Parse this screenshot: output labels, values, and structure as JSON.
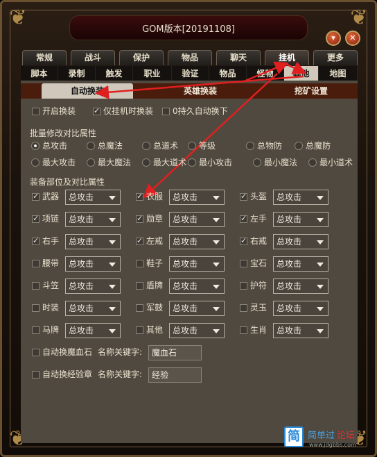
{
  "window": {
    "title": "GOM版本[20191108]",
    "minimize_glyph": "▾",
    "close_glyph": "✕"
  },
  "tabs_level1": [
    "常规",
    "战斗",
    "保护",
    "物品",
    "聊天",
    "挂机",
    "更多"
  ],
  "tabs_level1_active": "挂机",
  "tabs_level2": [
    "脚本",
    "录制",
    "触发",
    "职业",
    "验证",
    "物品",
    "怪物",
    "其他",
    "地图"
  ],
  "tabs_level2_active": "其他",
  "tabs_level3": [
    "自动换装",
    "英雄换装",
    "挖矿设置"
  ],
  "tabs_level3_active": "自动换装",
  "options": [
    {
      "label": "开启换装",
      "checked": false
    },
    {
      "label": "仅挂机时换装",
      "checked": true
    },
    {
      "label": "0持久自动换下",
      "checked": false
    }
  ],
  "batch_section": "批量修改对比属性",
  "radios_row1": [
    {
      "label": "总攻击",
      "checked": true
    },
    {
      "label": "总魔法",
      "checked": false
    },
    {
      "label": "总道术",
      "checked": false
    },
    {
      "label": "等级",
      "checked": false
    },
    {
      "label": "总物防",
      "checked": false
    },
    {
      "label": "总魔防",
      "checked": false
    }
  ],
  "radios_row2": [
    {
      "label": "最大攻击",
      "checked": false
    },
    {
      "label": "最大魔法",
      "checked": false
    },
    {
      "label": "最大道术",
      "checked": false
    },
    {
      "label": "最小攻击",
      "checked": false
    },
    {
      "label": "最小魔法",
      "checked": false
    },
    {
      "label": "最小道术",
      "checked": false
    }
  ],
  "equip_section": "装备部位及对比属性",
  "equipment": [
    {
      "label": "武器",
      "checked": true,
      "value": "总攻击"
    },
    {
      "label": "衣服",
      "checked": true,
      "value": "总攻击"
    },
    {
      "label": "头盔",
      "checked": true,
      "value": "总攻击"
    },
    {
      "label": "项链",
      "checked": true,
      "value": "总攻击"
    },
    {
      "label": "勋章",
      "checked": true,
      "value": "总攻击"
    },
    {
      "label": "左手",
      "checked": true,
      "value": "总攻击"
    },
    {
      "label": "右手",
      "checked": true,
      "value": "总攻击"
    },
    {
      "label": "左戒",
      "checked": true,
      "value": "总攻击"
    },
    {
      "label": "右戒",
      "checked": true,
      "value": "总攻击"
    },
    {
      "label": "腰带",
      "checked": false,
      "value": "总攻击"
    },
    {
      "label": "鞋子",
      "checked": false,
      "value": "总攻击"
    },
    {
      "label": "宝石",
      "checked": false,
      "value": "总攻击"
    },
    {
      "label": "斗笠",
      "checked": false,
      "value": "总攻击"
    },
    {
      "label": "盾牌",
      "checked": false,
      "value": "总攻击"
    },
    {
      "label": "护符",
      "checked": false,
      "value": "总攻击"
    },
    {
      "label": "时装",
      "checked": false,
      "value": "总攻击"
    },
    {
      "label": "军鼓",
      "checked": false,
      "value": "总攻击"
    },
    {
      "label": "灵玉",
      "checked": false,
      "value": "总攻击"
    },
    {
      "label": "马牌",
      "checked": false,
      "value": "总攻击"
    },
    {
      "label": "其他",
      "checked": false,
      "value": "总攻击"
    },
    {
      "label": "生肖",
      "checked": false,
      "value": "总攻击"
    }
  ],
  "auto_items": [
    {
      "label": "自动换魔血石",
      "checked": false,
      "keyword_label": "名称关键字:",
      "keyword": "魔血石"
    },
    {
      "label": "自动换经验章",
      "checked": false,
      "keyword_label": "名称关键字:",
      "keyword": "经验"
    }
  ],
  "watermark": {
    "logo": "简",
    "text1": "简单过",
    "text2": "论坛",
    "url": "www.jdgbbs.com"
  },
  "colors": {
    "arrow": "#e02020",
    "active_tab": "#cfc8bb",
    "subtab_bar": "#4a1c0c",
    "panel": "#4f4940"
  }
}
